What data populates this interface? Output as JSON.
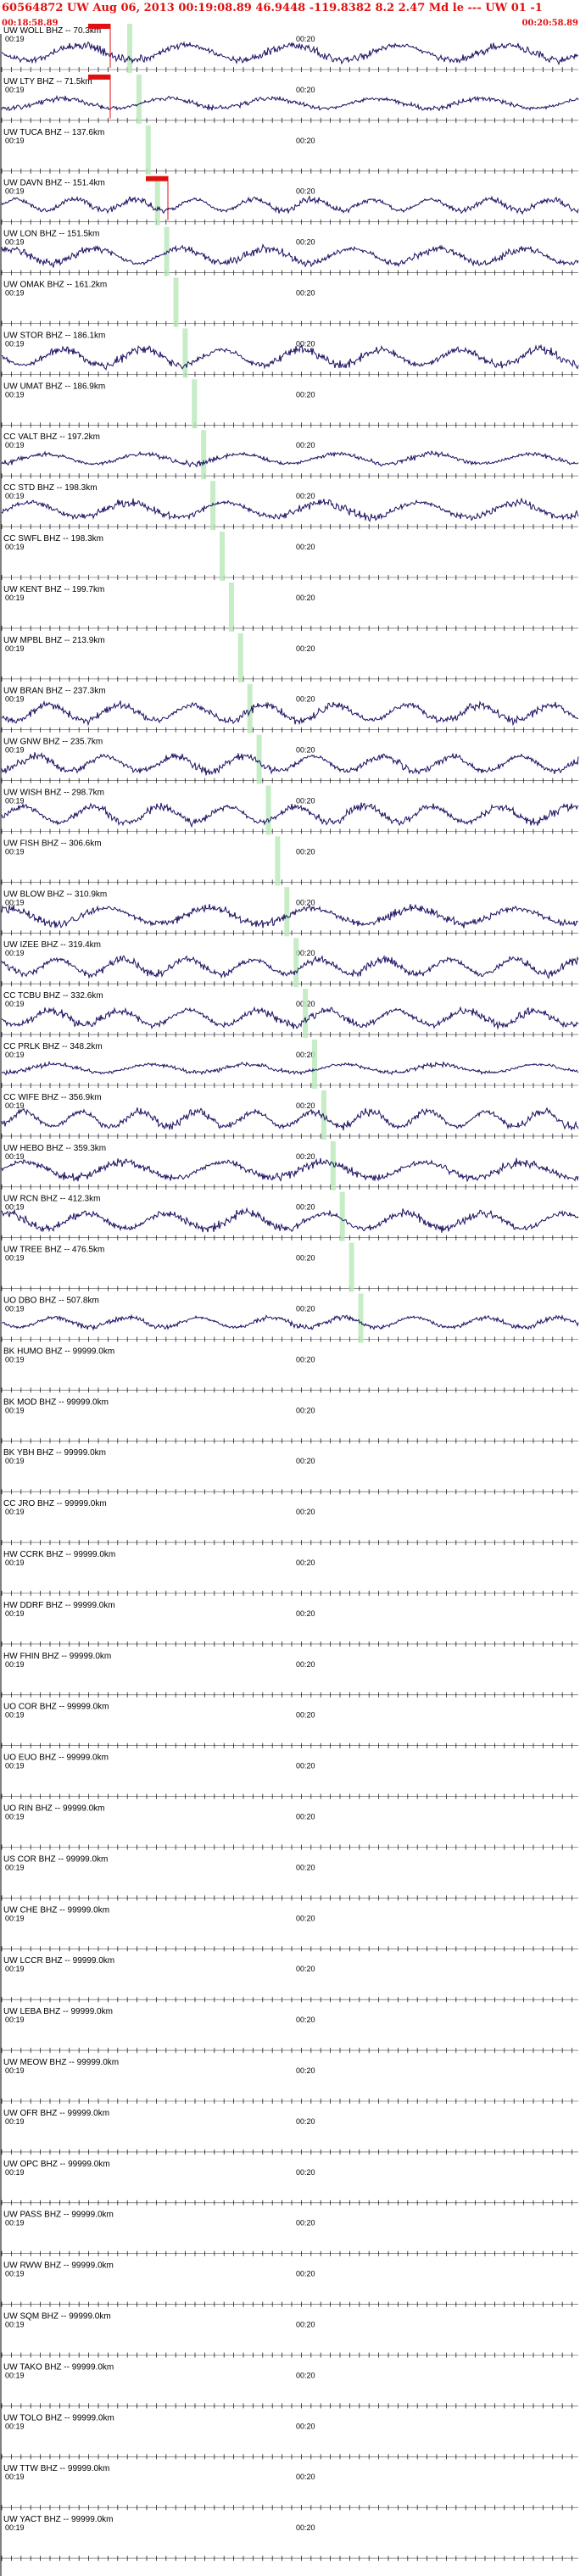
{
  "header": {
    "title": "60564872 UW Aug 06, 2013 00:19:08.89   46.9448  -119.8382  8.2 2.47 Md le --- UW 01  -1",
    "start_time": "00:18:58.89",
    "end_time": "00:20:58.89"
  },
  "colors": {
    "header": "#e01010",
    "trace": "#1a1060",
    "pick_marker": "#e01010",
    "phase_window": "#b8e8b8",
    "axis": "#000000"
  },
  "chart_data": {
    "type": "line",
    "x_tick_labels": [
      "00:19",
      "00:20"
    ],
    "traces": [
      {
        "label": "UW WOLL BHZ -- 70.3km",
        "amp": 0.9
      },
      {
        "label": "UW LTY BHZ -- 71.5km",
        "amp": 0.6
      },
      {
        "label": "UW TUCA BHZ -- 137.6km",
        "amp": 0.0
      },
      {
        "label": "UW DAVN BHZ -- 151.4km",
        "amp": 0.7
      },
      {
        "label": "UW LON BHZ -- 151.5km",
        "amp": 0.9
      },
      {
        "label": "UW OMAK BHZ -- 161.2km",
        "amp": 0.0
      },
      {
        "label": "UW STOR BHZ -- 186.1km",
        "amp": 0.95
      },
      {
        "label": "UW UMAT BHZ -- 186.9km",
        "amp": 0.0
      },
      {
        "label": "CC VALT BHZ -- 197.2km",
        "amp": 0.6
      },
      {
        "label": "CC STD BHZ -- 198.3km",
        "amp": 0.9
      },
      {
        "label": "CC SWFL BHZ -- 198.3km",
        "amp": 0.0
      },
      {
        "label": "UW KENT BHZ -- 199.7km",
        "amp": 0.0
      },
      {
        "label": "UW MPBL BHZ -- 213.9km",
        "amp": 0.0
      },
      {
        "label": "UW BRAN BHZ -- 237.3km",
        "amp": 0.95
      },
      {
        "label": "UW GNW BHZ -- 235.7km",
        "amp": 0.9
      },
      {
        "label": "UW WISH BHZ -- 298.7km",
        "amp": 0.95
      },
      {
        "label": "UW FISH BHZ -- 306.6km",
        "amp": 0.0
      },
      {
        "label": "UW BLOW BHZ -- 310.9km",
        "amp": 0.95
      },
      {
        "label": "UW IZEE BHZ -- 319.4km",
        "amp": 0.9
      },
      {
        "label": "CC TCBU BHZ -- 332.6km",
        "amp": 0.9
      },
      {
        "label": "CC PRLK BHZ -- 348.2km",
        "amp": 0.5
      },
      {
        "label": "CC WIFE BHZ -- 356.9km",
        "amp": 0.9
      },
      {
        "label": "UW HEBO BHZ -- 359.3km",
        "amp": 0.95
      },
      {
        "label": "UW RCN BHZ -- 412.3km",
        "amp": 0.95
      },
      {
        "label": "UW TREE BHZ -- 476.5km",
        "amp": 0.0
      },
      {
        "label": "UO DBO BHZ -- 507.8km",
        "amp": 0.6
      },
      {
        "label": "BK HUMO BHZ -- 99999.0km",
        "amp": 0.0
      },
      {
        "label": "BK MOD BHZ -- 99999.0km",
        "amp": 0.0
      },
      {
        "label": "BK YBH BHZ -- 99999.0km",
        "amp": 0.0
      },
      {
        "label": "CC JRO BHZ -- 99999.0km",
        "amp": 0.0
      },
      {
        "label": "HW CCRK BHZ -- 99999.0km",
        "amp": 0.0
      },
      {
        "label": "HW DDRF BHZ -- 99999.0km",
        "amp": 0.0
      },
      {
        "label": "HW FHIN BHZ -- 99999.0km",
        "amp": 0.0
      },
      {
        "label": "UO COR BHZ -- 99999.0km",
        "amp": 0.0
      },
      {
        "label": "UO EUO BHZ -- 99999.0km",
        "amp": 0.0
      },
      {
        "label": "UO RIN BHZ -- 99999.0km",
        "amp": 0.0
      },
      {
        "label": "US COR BHZ -- 99999.0km",
        "amp": 0.0
      },
      {
        "label": "UW CHE BHZ -- 99999.0km",
        "amp": 0.0
      },
      {
        "label": "UW LCCR BHZ -- 99999.0km",
        "amp": 0.0
      },
      {
        "label": "UW LEBA BHZ -- 99999.0km",
        "amp": 0.0
      },
      {
        "label": "UW MEOW BHZ -- 99999.0km",
        "amp": 0.0
      },
      {
        "label": "UW OFR BHZ -- 99999.0km",
        "amp": 0.0
      },
      {
        "label": "UW OPC BHZ -- 99999.0km",
        "amp": 0.0
      },
      {
        "label": "UW PASS BHZ -- 99999.0km",
        "amp": 0.0
      },
      {
        "label": "UW RWW BHZ -- 99999.0km",
        "amp": 0.0
      },
      {
        "label": "UW SQM BHZ -- 99999.0km",
        "amp": 0.0
      },
      {
        "label": "UW TAKO BHZ -- 99999.0km",
        "amp": 0.0
      },
      {
        "label": "UW TOLO BHZ -- 99999.0km",
        "amp": 0.0
      },
      {
        "label": "UW TTW BHZ -- 99999.0km",
        "amp": 0.0
      },
      {
        "label": "UW YACT BHZ -- 99999.0km",
        "amp": 0.0
      }
    ]
  }
}
